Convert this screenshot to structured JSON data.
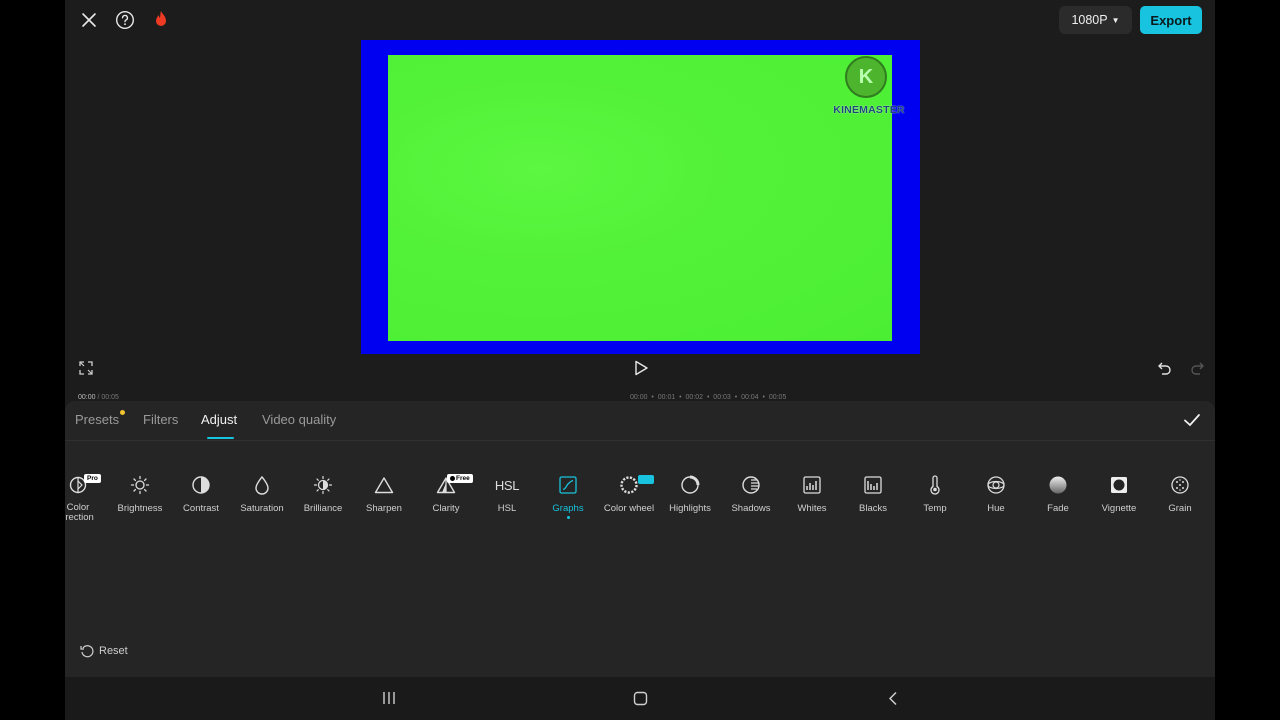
{
  "header": {
    "close_icon": "close-icon",
    "help_icon": "help-icon",
    "fire_icon": "fire-icon",
    "resolution_label": "1080P",
    "export_label": "Export",
    "accent_color": "#17c3de"
  },
  "preview": {
    "logo_letter": "K",
    "logo_text": "KINEMASTER",
    "border_color": "#0000f0",
    "content_color": "#4cee34"
  },
  "playback": {
    "current_time": "00:00",
    "total_time": "/ 00:05",
    "ticks": [
      "00:00",
      "00:01",
      "00:02",
      "00:03",
      "00:04",
      "00:05"
    ]
  },
  "panel": {
    "tabs": [
      {
        "label": "Presets"
      },
      {
        "label": "Filters"
      },
      {
        "label": "Adjust"
      },
      {
        "label": "Video quality"
      }
    ],
    "active_tab": "Adjust",
    "tools": [
      {
        "label": "Color\nrrection",
        "badge": "Pro"
      },
      {
        "label": "Brightness"
      },
      {
        "label": "Contrast"
      },
      {
        "label": "Saturation"
      },
      {
        "label": "Brilliance"
      },
      {
        "label": "Sharpen"
      },
      {
        "label": "Clarity",
        "badge": "Free"
      },
      {
        "label": "HSL",
        "icon_text": "HSL"
      },
      {
        "label": "Graphs"
      },
      {
        "label": "Color wheel"
      },
      {
        "label": "Highlights"
      },
      {
        "label": "Shadows"
      },
      {
        "label": "Whites"
      },
      {
        "label": "Blacks"
      },
      {
        "label": "Temp"
      },
      {
        "label": "Hue"
      },
      {
        "label": "Fade"
      },
      {
        "label": "Vignette"
      },
      {
        "label": "Grain"
      }
    ],
    "reset_label": "Reset"
  }
}
